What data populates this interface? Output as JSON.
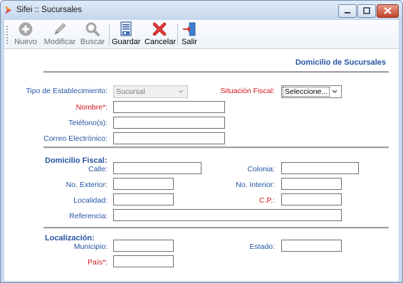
{
  "window": {
    "title": "Sifei :: Sucursales"
  },
  "toolbar": {
    "nuevo": "Nuevo",
    "modificar": "Modificar",
    "buscar": "Buscar",
    "guardar": "Guardar",
    "cancelar": "Cancelar",
    "salir": "Salir"
  },
  "form": {
    "section_title": "Domicilio de Sucursales",
    "tipo_establecimiento": {
      "label": "Tipo de Establecimiento:",
      "value": "Sucursal"
    },
    "situacion_fiscal": {
      "label": "Situación Fiscal:",
      "value": "Seleccione..."
    },
    "nombre": {
      "label": "Nombre*:",
      "value": ""
    },
    "telefonos": {
      "label": "Teléfono(s):",
      "value": ""
    },
    "correo": {
      "label": "Correo Electrónico:",
      "value": ""
    },
    "domicilio_fiscal": {
      "title": "Domicilio Fiscal:",
      "calle": "Calle:",
      "colonia": "Colonia:",
      "no_exterior": "No. Exterior:",
      "no_interior": "No. Interior:",
      "localidad": "Localidad:",
      "cp": "C.P.:",
      "referencia": "Referencia:"
    },
    "localizacion": {
      "title": "Localización:",
      "municipio": "Municipio:",
      "estado": "Estado:",
      "pais": "País*:"
    }
  },
  "colors": {
    "label_blue": "#2553a3",
    "required_red": "#d4141c",
    "title_bar": "#c5d7ed"
  },
  "icons": [
    "app-icon",
    "add-icon",
    "pencil-icon",
    "magnifier-icon",
    "save-document-icon",
    "red-x-icon",
    "exit-door-icon",
    "minimize-icon",
    "maximize-icon",
    "close-icon"
  ]
}
